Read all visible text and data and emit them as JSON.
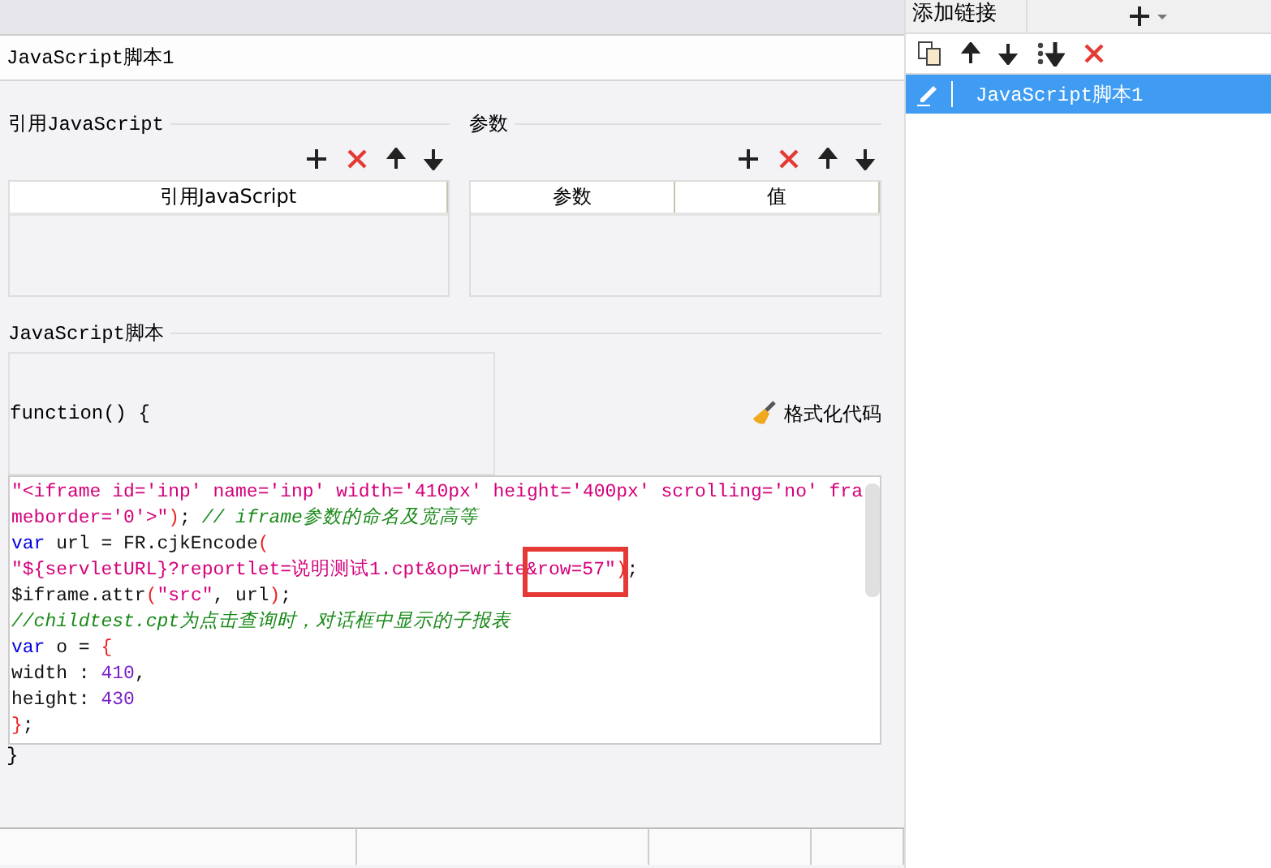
{
  "window": {
    "title": "JavaScript脚本1"
  },
  "right_panel": {
    "tab": "添加链接",
    "items": [
      {
        "label": "JavaScript脚本1",
        "selected": true
      }
    ]
  },
  "imports": {
    "title": "引用JavaScript",
    "columns": [
      "引用JavaScript"
    ]
  },
  "params": {
    "title": "参数",
    "columns": [
      "参数",
      "值"
    ]
  },
  "script": {
    "title": "JavaScript脚本",
    "header": "function() {",
    "format_button": "格式化代码",
    "footer": "}",
    "code_lines": [
      [
        {
          "kind": "str",
          "text": "\"<iframe id='inp' name='inp' width='410px' height='400px' scrolling='no' frameborder='0'>\""
        },
        {
          "kind": "paren",
          "text": ")"
        },
        {
          "kind": "plain",
          "text": "; "
        },
        {
          "kind": "comment",
          "text": "// iframe参数的命名及宽高等"
        }
      ],
      [
        {
          "kind": "kw",
          "text": "var"
        },
        {
          "kind": "plain",
          "text": " url = FR.cjkEncode"
        },
        {
          "kind": "paren",
          "text": "("
        }
      ],
      [
        {
          "kind": "str",
          "text": "\"${servletURL}?reportlet=说明测试1.cpt&op=write"
        },
        {
          "kind": "str",
          "text": "&row=57\"",
          "boxed": true
        },
        {
          "kind": "paren",
          "text": ")"
        },
        {
          "kind": "plain",
          "text": ";"
        }
      ],
      [
        {
          "kind": "plain",
          "text": "$iframe.attr"
        },
        {
          "kind": "paren",
          "text": "("
        },
        {
          "kind": "str",
          "text": "\"src\""
        },
        {
          "kind": "plain",
          "text": ", url"
        },
        {
          "kind": "paren",
          "text": ")"
        },
        {
          "kind": "plain",
          "text": ";"
        }
      ],
      [
        {
          "kind": "comment",
          "text": "//childtest.cpt为点击查询时，对话框中显示的子报表"
        }
      ],
      [
        {
          "kind": "kw",
          "text": "var"
        },
        {
          "kind": "plain",
          "text": " o = "
        },
        {
          "kind": "paren",
          "text": "{"
        }
      ],
      [
        {
          "kind": "plain",
          "text": "width : "
        },
        {
          "kind": "num",
          "text": "410"
        },
        {
          "kind": "plain",
          "text": ","
        }
      ],
      [
        {
          "kind": "plain",
          "text": "height: "
        },
        {
          "kind": "num",
          "text": "430"
        }
      ],
      [
        {
          "kind": "paren",
          "text": "}"
        },
        {
          "kind": "plain",
          "text": ";"
        }
      ]
    ]
  }
}
